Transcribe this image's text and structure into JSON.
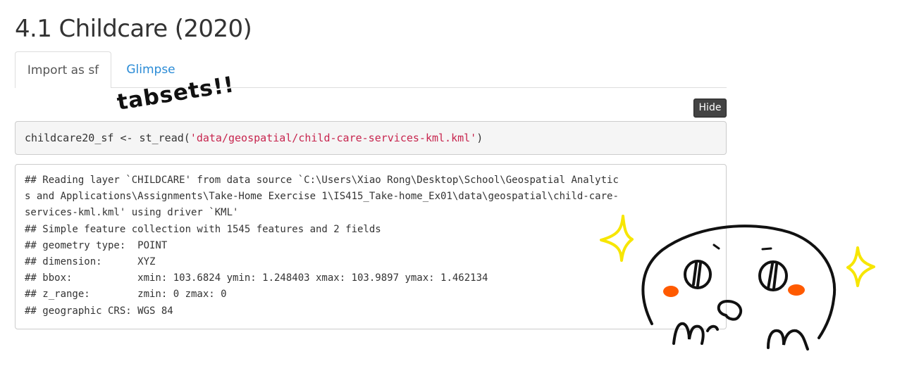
{
  "page": {
    "heading": "4.1 Childcare (2020)"
  },
  "tabs": [
    {
      "label": "Import as sf",
      "active": true
    },
    {
      "label": "Glimpse",
      "active": false
    }
  ],
  "hide_button": {
    "label": "Hide"
  },
  "code": {
    "prefix": "childcare20_sf <- st_read(",
    "string": "'data/geospatial/child-care-services-kml.kml'",
    "suffix": ")"
  },
  "output": {
    "lines": [
      "## Reading layer `CHILDCARE' from data source `C:\\Users\\Xiao Rong\\Desktop\\School\\Geospatial Analytic",
      "s and Applications\\Assignments\\Take-Home Exercise 1\\IS415_Take-home_Ex01\\data\\geospatial\\child-care-",
      "services-kml.kml' using driver `KML'",
      "## Simple feature collection with 1545 features and 2 fields",
      "## geometry type:  POINT",
      "## dimension:      XYZ",
      "## bbox:           xmin: 103.6824 ymin: 1.248403 xmax: 103.9897 ymax: 1.462134",
      "## z_range:        zmin: 0 zmax: 0",
      "## geographic CRS: WGS 84"
    ]
  },
  "annotation": {
    "handwritten_text": "tabsets!!",
    "colors": {
      "ink": "#111111",
      "sparkle": "#f7e600",
      "blush": "#ff5a00"
    }
  },
  "colors": {
    "heading": "#333333",
    "tab_link": "#2a8bd6",
    "code_string": "#c7254e",
    "button_bg": "#434343"
  }
}
